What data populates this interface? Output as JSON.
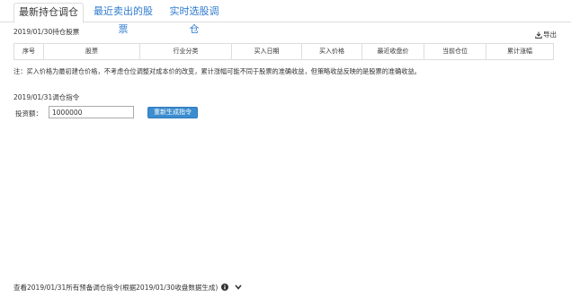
{
  "tabs": [
    {
      "label": "最新持仓调仓"
    },
    {
      "label": "最近卖出的股票"
    },
    {
      "label": "实时选股调仓"
    }
  ],
  "holdings": {
    "title": "2019/01/30持仓股票",
    "export_label": "导出",
    "columns": [
      "序号",
      "股票",
      "行业分类",
      "买入日期",
      "买入价格",
      "最近收盘价",
      "当前仓位",
      "累计涨幅"
    ]
  },
  "note": "注：买入价格为最初建仓价格，不考虑仓位调整对成本价的改变，累计涨幅可能不同于股票的准确收益，但策略收益反映的是股票的准确收益。",
  "rebalance": {
    "title": "2019/01/31调仓指令",
    "investment_label": "投资额：",
    "investment_value": "1000000",
    "regenerate_label": "重新生成指令"
  },
  "footer": {
    "text": "查看2019/01/31所有预备调仓指令(根据2019/01/30收盘数据生成)"
  },
  "colors": {
    "accent": "#2f7bd0",
    "button": "#3c8dcf",
    "border": "#dddddd"
  }
}
